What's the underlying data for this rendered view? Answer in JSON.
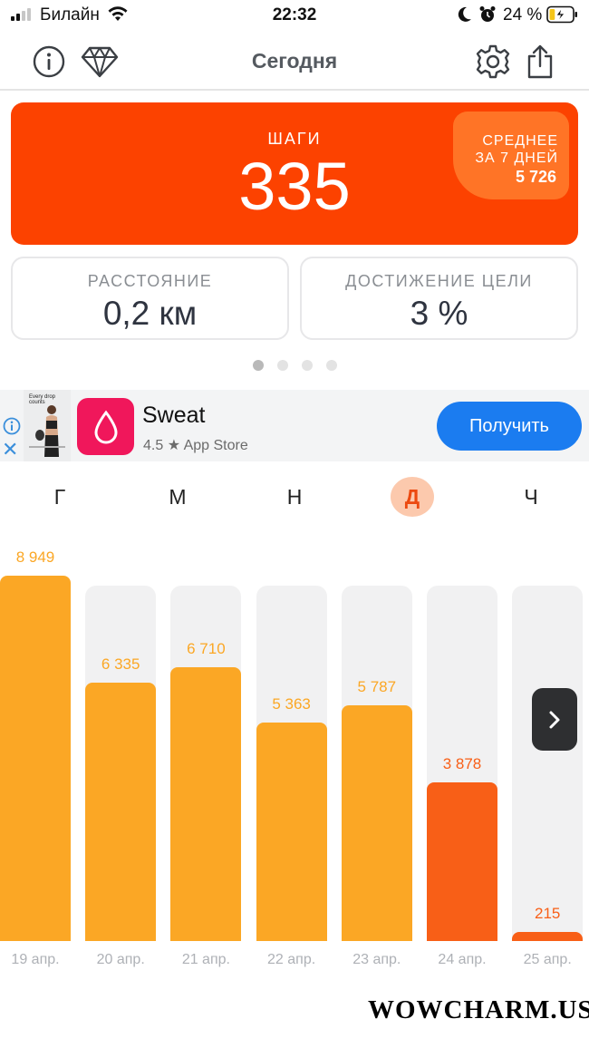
{
  "status_bar": {
    "carrier": "Билайн",
    "time": "22:32",
    "battery_percent": "24 %",
    "battery_level": 0.24
  },
  "header": {
    "title": "Сегодня",
    "icons": [
      "info-icon",
      "diamond-icon",
      "gear-icon",
      "share-icon"
    ]
  },
  "steps": {
    "label": "ШАГИ",
    "value": "335",
    "avg_line1": "СРЕДНЕЕ",
    "avg_line2": "ЗА 7 ДНЕЙ",
    "avg_value": "5 726"
  },
  "distance": {
    "label": "РАССТОЯНИЕ",
    "value": "0,2 км"
  },
  "goal": {
    "label": "ДОСТИЖЕНИЕ ЦЕЛИ",
    "value": "3 %"
  },
  "pager": {
    "count": 4,
    "active": 0
  },
  "ad": {
    "thumb_caption": "Every drop counts",
    "app_name": "Sweat",
    "rating": "4.5 ★ App Store",
    "button": "Получить"
  },
  "weekdays": [
    {
      "letter": "Г",
      "active": false
    },
    {
      "letter": "М",
      "active": false
    },
    {
      "letter": "Н",
      "active": false
    },
    {
      "letter": "Д",
      "active": true
    },
    {
      "letter": "Ч",
      "active": false
    }
  ],
  "colors": {
    "accent": "#fc4200",
    "bar_past": "#fba725",
    "bar_recent": "#f85f17",
    "avg_box": "#ff7426",
    "button_blue": "#1b7cf0"
  },
  "chart_data": {
    "type": "bar",
    "categories": [
      "19 апр.",
      "20 апр.",
      "21 апр.",
      "22 апр.",
      "23 апр.",
      "24 апр.",
      "25 апр."
    ],
    "values": [
      8949,
      6335,
      6710,
      5363,
      5787,
      3878,
      215
    ],
    "value_labels": [
      "8 949",
      "6 335",
      "6 710",
      "5 363",
      "5 787",
      "3 878",
      "215"
    ],
    "ylim": [
      0,
      10000
    ],
    "highlighted": [
      false,
      false,
      false,
      false,
      false,
      true,
      true
    ]
  },
  "watermark": "WOWCHARM.US"
}
